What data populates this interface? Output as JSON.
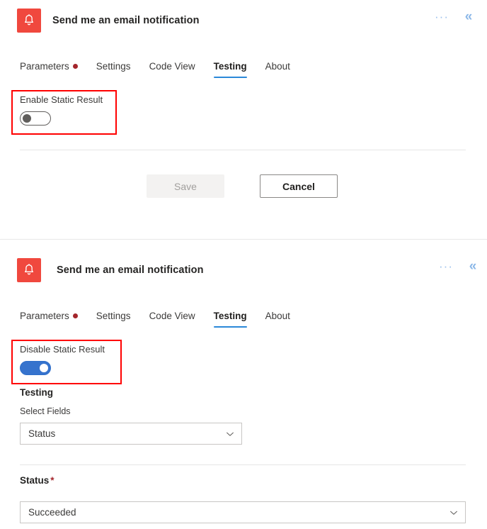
{
  "panels": [
    {
      "header": {
        "icon": "bell-icon",
        "icon_color": "#F0483E",
        "title": "Send me an email notification",
        "ellipsis_label": "···",
        "collapse_label": "«"
      },
      "tabs": [
        {
          "label": "Parameters",
          "has_dot": true,
          "active": false
        },
        {
          "label": "Settings",
          "has_dot": false,
          "active": false
        },
        {
          "label": "Code View",
          "has_dot": false,
          "active": false
        },
        {
          "label": "Testing",
          "has_dot": false,
          "active": true
        },
        {
          "label": "About",
          "has_dot": false,
          "active": false
        }
      ],
      "static_result": {
        "label": "Enable Static Result",
        "state": "off"
      },
      "buttons": {
        "save_label": "Save",
        "cancel_label": "Cancel"
      }
    },
    {
      "header": {
        "icon": "bell-icon",
        "icon_color": "#F0483E",
        "title": "Send me an email notification",
        "ellipsis_label": "···",
        "collapse_label": "«"
      },
      "tabs": [
        {
          "label": "Parameters",
          "has_dot": true,
          "active": false
        },
        {
          "label": "Settings",
          "has_dot": false,
          "active": false
        },
        {
          "label": "Code View",
          "has_dot": false,
          "active": false
        },
        {
          "label": "Testing",
          "has_dot": false,
          "active": true
        },
        {
          "label": "About",
          "has_dot": false,
          "active": false
        }
      ],
      "static_result": {
        "label": "Disable Static Result",
        "state": "on"
      },
      "testing": {
        "heading": "Testing",
        "select_fields_label": "Select Fields",
        "select_fields_value": "Status",
        "status_label": "Status",
        "status_required_mark": "*",
        "status_value": "Succeeded"
      }
    }
  ],
  "colors": {
    "accent_blue": "#2B88D8",
    "toggle_on": "#3673CD",
    "brand_red": "#F0483E",
    "annotation_red": "#FF0000",
    "required_red": "#A4262C"
  }
}
